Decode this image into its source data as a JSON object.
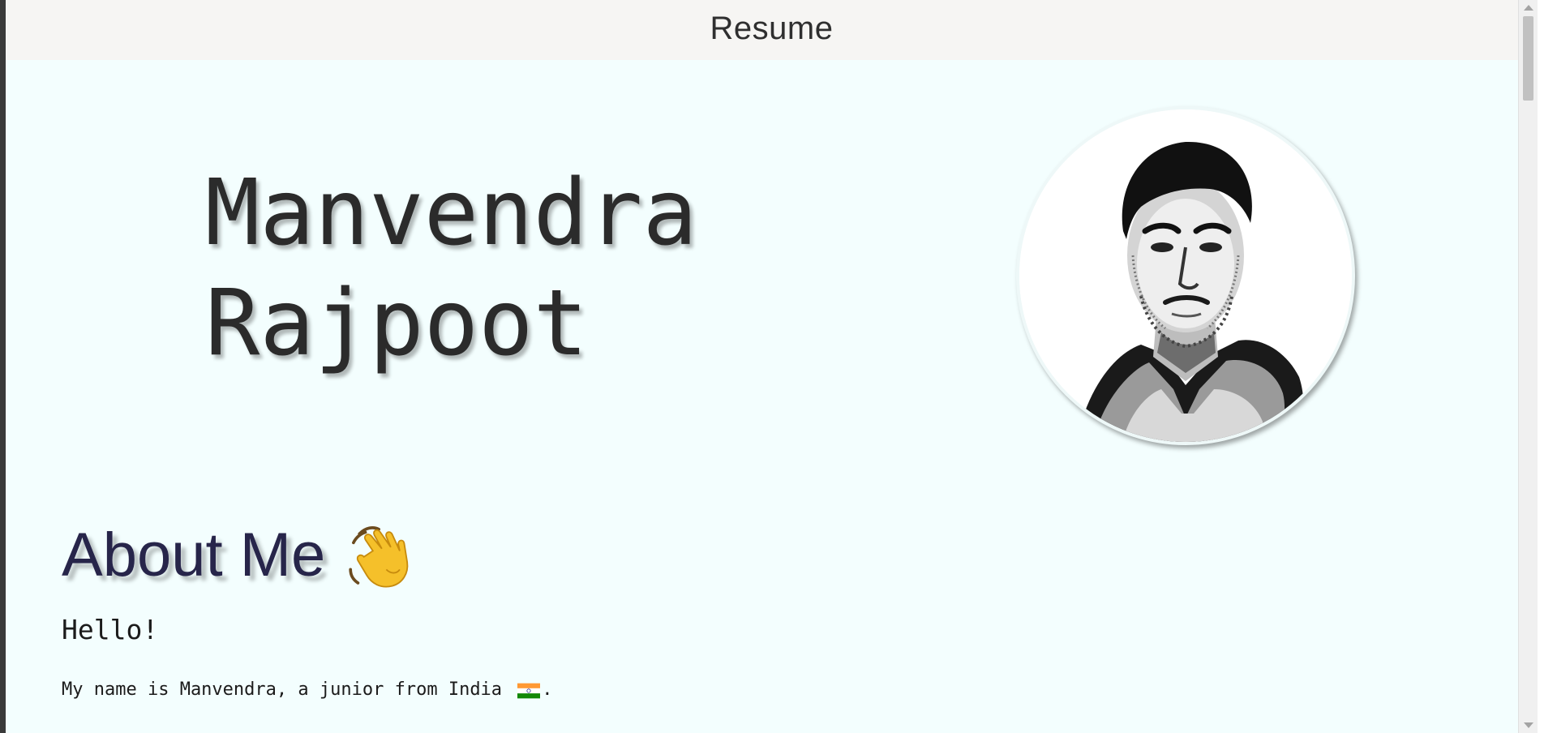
{
  "header": {
    "title": "Resume"
  },
  "hero": {
    "first_name": "Manvendra",
    "last_name": "Rajpoot",
    "avatar_icon": "profile-photo"
  },
  "about": {
    "heading": "About Me",
    "heading_emoji": "waving-hand-icon",
    "greeting": "Hello!",
    "intro_before_flag": "My name is Manvendra, a junior from India ",
    "flag_icon": "india-flag-icon",
    "intro_after_flag": "."
  },
  "colors": {
    "page_background": "#f3fefe",
    "topbar_background": "#f6f5f3",
    "heading_color": "#27254a",
    "name_color": "#2b2b2b"
  }
}
